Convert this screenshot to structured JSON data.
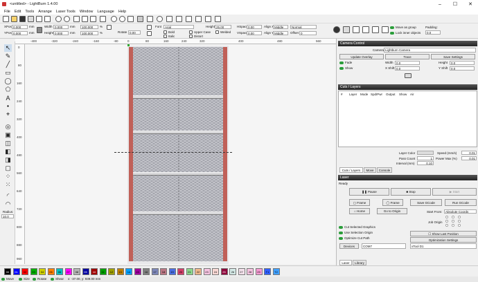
{
  "window": {
    "title": "<untitled> - LightBurn 1.4.00"
  },
  "menu": [
    "File",
    "Edit",
    "Tools",
    "Arrange",
    "Laser Tools",
    "Window",
    "Language",
    "Help"
  ],
  "toolbar2": {
    "xpos_label": "XPos",
    "xpos": "0.000",
    "ypos_label": "YPos",
    "ypos": "0.000",
    "unit": "mm",
    "width_label": "Width",
    "width": "0.000",
    "height_label": "Height",
    "height": "0.000",
    "w_pct": "100.000",
    "h_pct": "100.000",
    "pct": "%",
    "rotate_label": "Rotate",
    "rotate": "0.00",
    "font_label": "Font",
    "font": "Arial",
    "bold": "Bold",
    "italic": "Italic",
    "upper_case": "Upper Case",
    "welded": "Welded",
    "distort": "Distort",
    "height2_label": "Height",
    "height2": "25.00",
    "hspace_label": "HSpace",
    "hspace": "0.00",
    "vspace_label": "VSpace",
    "vspace": "0.00",
    "align_x_label": "Align X",
    "align_x": "Middle",
    "align_y_label": "Align Y",
    "align_y": "Middle",
    "normal": "Normal",
    "offset_label": "Offset",
    "offset": "0",
    "move_as_group": "Move as group",
    "lock_inner": "Lock inner objects",
    "padding_label": "Padding:",
    "padding": "0.0"
  },
  "ruler_top": [
    "-400",
    "-320",
    "-240",
    "-160",
    "-80",
    "0",
    "80",
    "160",
    "240",
    "320",
    "400",
    "480",
    "560"
  ],
  "ruler_left": [
    "0",
    "80",
    "160",
    "240",
    "320",
    "400",
    "480",
    "560",
    "640",
    "720",
    "800",
    "880",
    "960"
  ],
  "left_tools": {
    "radius_label": "Radius:",
    "radius": "10.0"
  },
  "camera": {
    "title": "Camera Control",
    "camera_label": "Camera:",
    "camera": "Lightburn Camera",
    "update_overlay": "Update Overlay",
    "trace": "Trace",
    "save_settings": "Save Settings",
    "fade": "Fade",
    "show": "Show",
    "width_label": "Width",
    "width": "0.0",
    "xshift_label": "X Shift",
    "xshift": "0.0",
    "height_label": "Height",
    "height": "0.0",
    "yshift_label": "Y Shift",
    "yshift": "0.0"
  },
  "cuts": {
    "title": "Cuts / Layers",
    "headers": [
      "#",
      "Layer",
      "Mode",
      "Spd/Pwr",
      "Output",
      "Show",
      "Air"
    ],
    "layer_color_label": "Layer Color",
    "speed_label": "Speed (mm/s)",
    "speed": "0.01",
    "pass_count_label": "Pass Count",
    "pass_count": "1",
    "power_max_label": "Power Max (%)",
    "power_max": "0.01",
    "interval_label": "Interval (mm)",
    "interval": "0.10",
    "tabs": [
      "Cuts / Layers",
      "Move",
      "Console"
    ]
  },
  "laser": {
    "title": "Laser",
    "status": "Ready",
    "pause": "Pause",
    "stop": "Stop",
    "start": "Start",
    "frame1": "Frame",
    "frame2": "Frame",
    "save_gcode": "Save GCode",
    "run_gcode": "Run GCode",
    "home": "Home",
    "go_to_origin": "Go to Origin",
    "start_from_label": "Start From:",
    "start_from": "Absolute Coords",
    "job_origin_label": "Job Origin",
    "cut_selected": "Cut Selected Graphics",
    "use_selection_origin": "Use Selection Origin",
    "show_last_position": "Show Last Position",
    "optimize_cut_path": "Optimize Cut Path",
    "optimization_settings": "Optimization Settings",
    "devices": "Devices",
    "port": "COM7",
    "device": "xTool D1",
    "tabs": [
      "Laser",
      "Library"
    ]
  },
  "palette": [
    {
      "label": "00",
      "color": "#000000"
    },
    {
      "label": "01",
      "color": "#0000ff"
    },
    {
      "label": "02",
      "color": "#ff0000"
    },
    {
      "label": "03",
      "color": "#00b000"
    },
    {
      "label": "04",
      "color": "#d0d000"
    },
    {
      "label": "05",
      "color": "#ff8000"
    },
    {
      "label": "06",
      "color": "#00c0c0"
    },
    {
      "label": "07",
      "color": "#ff00ff"
    },
    {
      "label": "08",
      "color": "#b4b4b4"
    },
    {
      "label": "09",
      "color": "#0000a0"
    },
    {
      "label": "10",
      "color": "#a00000"
    },
    {
      "label": "11",
      "color": "#00a000"
    },
    {
      "label": "12",
      "color": "#a0a000"
    },
    {
      "label": "13",
      "color": "#c08000"
    },
    {
      "label": "14",
      "color": "#00a0ff"
    },
    {
      "label": "15",
      "color": "#a000a0"
    },
    {
      "label": "16",
      "color": "#808080"
    },
    {
      "label": "17",
      "color": "#7d87b9"
    },
    {
      "label": "18",
      "color": "#bb7784"
    },
    {
      "label": "19",
      "color": "#4a6fe3"
    },
    {
      "label": "20",
      "color": "#d33f6a"
    },
    {
      "label": "21",
      "color": "#8cd78c"
    },
    {
      "label": "22",
      "color": "#f0b98d"
    },
    {
      "label": "23",
      "color": "#f6c4e1"
    },
    {
      "label": "24",
      "color": "#fad9d5"
    },
    {
      "label": "25",
      "color": "#8e063b"
    },
    {
      "label": "26",
      "color": "#d5eae7"
    },
    {
      "label": "27",
      "color": "#f3e1eb"
    },
    {
      "label": "28",
      "color": "#f6c4e1"
    },
    {
      "label": "29",
      "color": "#f79cd4"
    },
    {
      "label": "T1",
      "color": "#3060ff"
    },
    {
      "label": "T2",
      "color": "#40a0ff"
    }
  ],
  "status": {
    "move": "Move",
    "size": "Size",
    "rotate": "Rotate",
    "shear": "Shear",
    "coords": "x: -37.00, y: 939.00 mm"
  }
}
